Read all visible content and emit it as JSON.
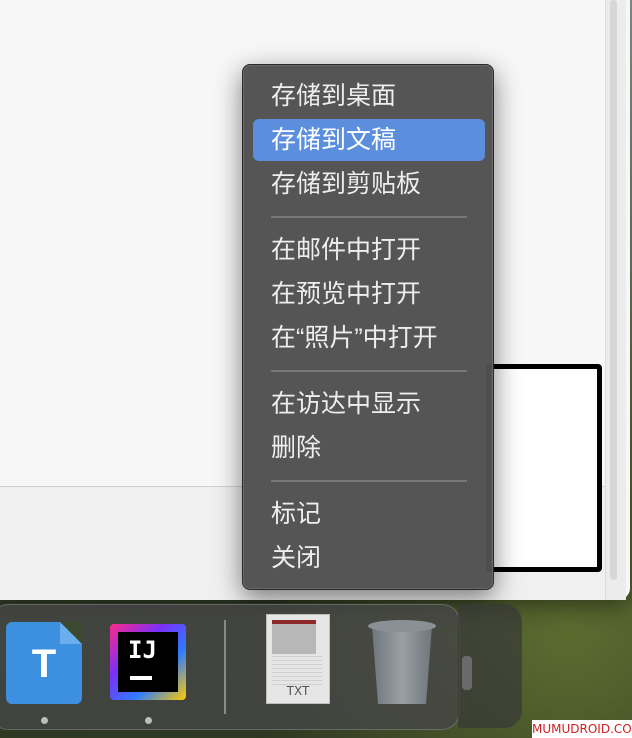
{
  "context_menu": {
    "items": [
      {
        "label": "存储到桌面",
        "selected": false
      },
      {
        "label": "存储到文稿",
        "selected": true
      },
      {
        "label": "存储到剪贴板",
        "selected": false
      },
      {
        "label": "在邮件中打开",
        "selected": false
      },
      {
        "label": "在预览中打开",
        "selected": false
      },
      {
        "label": "在“照片”中打开",
        "selected": false
      },
      {
        "label": "在访达中显示",
        "selected": false
      },
      {
        "label": "删除",
        "selected": false
      },
      {
        "label": "标记",
        "selected": false
      },
      {
        "label": "关闭",
        "selected": false
      }
    ],
    "selected_color": "#5b8fde"
  },
  "dock": {
    "apps": [
      {
        "name": "typora",
        "icon": "typora-app-icon",
        "letter": "T"
      },
      {
        "name": "intellij-idea",
        "icon": "intellij-idea-app-icon",
        "letter": "IJ"
      },
      {
        "name": "text-file",
        "icon": "txt-file-icon",
        "letter": "TXT"
      },
      {
        "name": "trash",
        "icon": "trash-icon"
      }
    ]
  },
  "watermark": {
    "text": "MUMUDROID.COM",
    "color": "#d11e1e"
  }
}
